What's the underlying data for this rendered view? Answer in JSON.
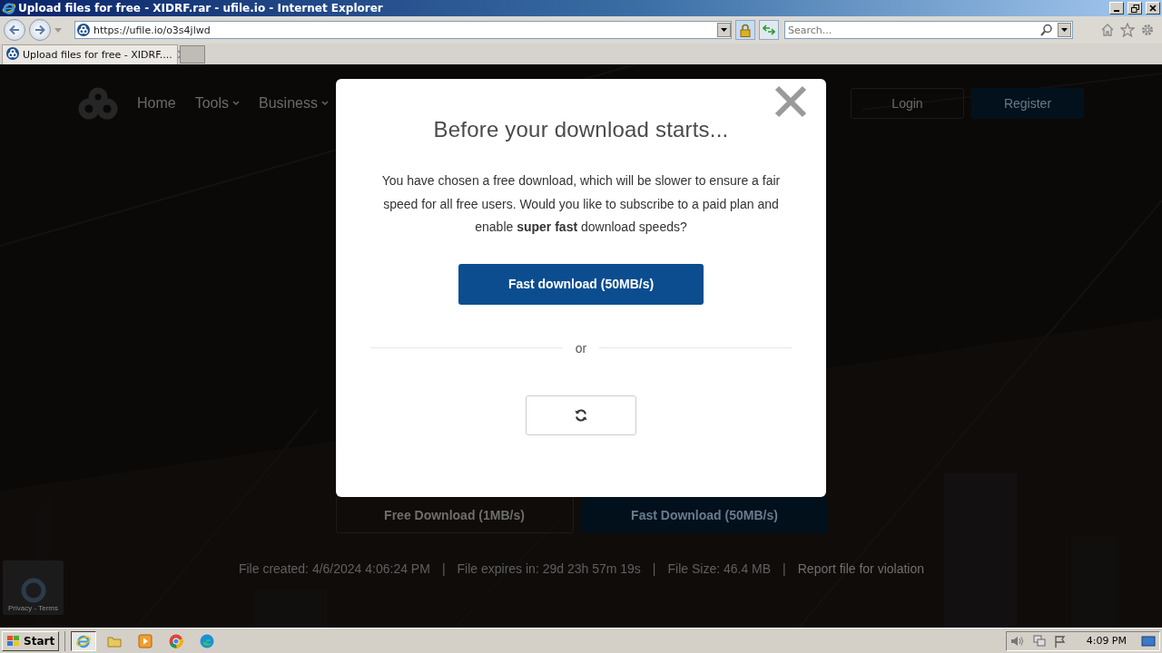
{
  "window": {
    "title": "Upload files for free - XIDRF.rar - ufile.io - Internet Explorer"
  },
  "address_bar": {
    "url": "https://ufile.io/o3s4jlwd",
    "secure": true
  },
  "search": {
    "placeholder": "Search..."
  },
  "tabs": [
    {
      "label": "Upload files for free - XIDRF....",
      "selected": true
    }
  ],
  "site_nav": {
    "items": [
      {
        "label": "Home",
        "dropdown": false
      },
      {
        "label": "Tools",
        "dropdown": true
      },
      {
        "label": "Business",
        "dropdown": true
      }
    ],
    "login": "Login",
    "register": "Register"
  },
  "download_buttons": [
    {
      "label": "Free Download (1MB/s)",
      "kind": "outline"
    },
    {
      "label": "Fast Download (50MB/s)",
      "kind": "primary"
    }
  ],
  "file_info": [
    {
      "text": "File created: 4/6/2024 4:06:24 PM",
      "kind": "text"
    },
    {
      "text": "|",
      "kind": "separator"
    },
    {
      "text": "File expires in: 29d 23h 57m 19s",
      "kind": "text"
    },
    {
      "text": "|",
      "kind": "separator"
    },
    {
      "text": "File Size: 46.4 MB",
      "kind": "text"
    },
    {
      "text": "|",
      "kind": "separator"
    },
    {
      "text": "Report file for violation",
      "kind": "link"
    }
  ],
  "recaptcha": {
    "links": "Privacy - Terms"
  },
  "modal": {
    "title": "Before your download starts...",
    "message": "You have chosen a free download, which will be slower to ensure a fair speed for all free users. Would you like to subscribe to a paid plan and enable **super fast** download speeds?",
    "primary_button": "Fast download (50MB/s)",
    "separator": "or"
  },
  "taskbar": {
    "start": "Start",
    "clock": "4:09 PM"
  }
}
